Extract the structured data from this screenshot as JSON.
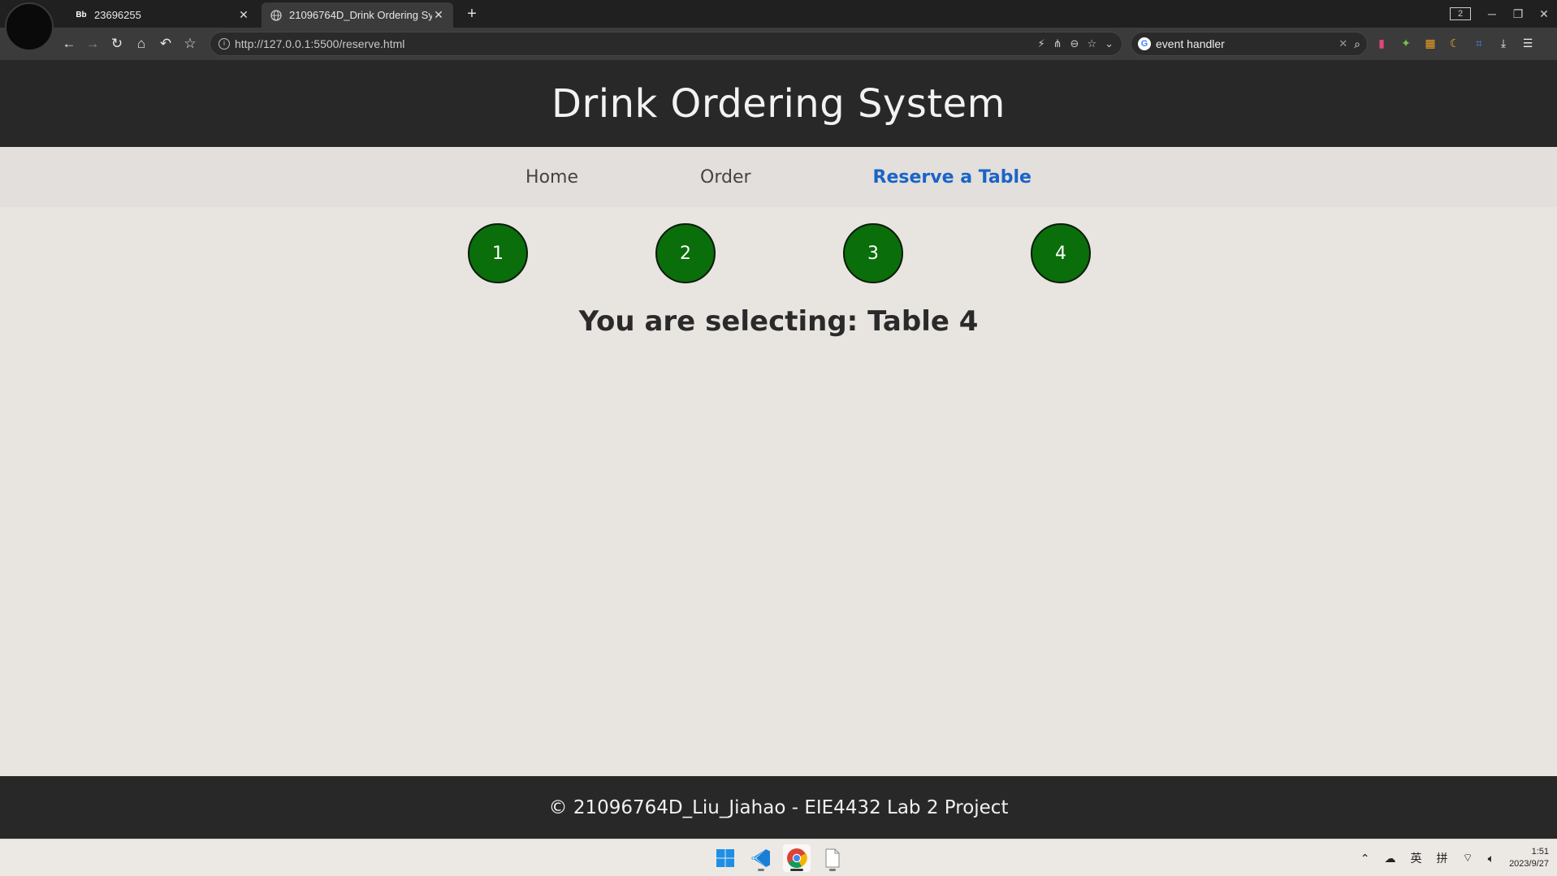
{
  "browser": {
    "tabs": [
      {
        "label": "23696255",
        "favicon": "Bb",
        "active": false
      },
      {
        "label": "21096764D_Drink Ordering Sy",
        "favicon": "globe-icon",
        "active": true
      }
    ],
    "window_count": "2",
    "address": "http://127.0.0.1:5500/reserve.html",
    "search_query": "event handler"
  },
  "site": {
    "title": "Drink Ordering System",
    "nav": [
      {
        "label": "Home",
        "active": false
      },
      {
        "label": "Order",
        "active": false
      },
      {
        "label": "Reserve a Table",
        "active": true
      }
    ],
    "tables": [
      "1",
      "2",
      "3",
      "4"
    ],
    "selection_text": "You are selecting: Table 4",
    "footer": "© 21096764D_Liu_Jiahao - EIE4432 Lab 2 Project",
    "colors": {
      "header_bg": "#282828",
      "table_circle": "#0a6e0a",
      "nav_active": "#1a64c8"
    }
  },
  "taskbar": {
    "tray_ime_1": "英",
    "tray_ime_2": "拼",
    "time": "1:51",
    "date": "2023/9/27"
  }
}
